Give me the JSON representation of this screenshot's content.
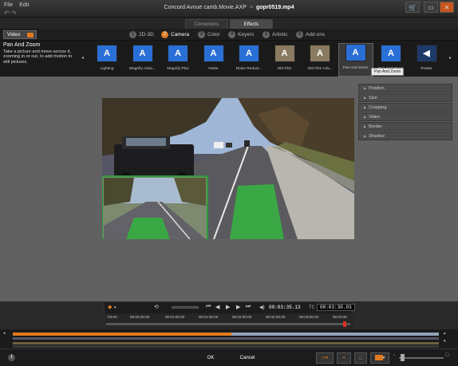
{
  "titlebar": {
    "menu": [
      "File",
      "Edit"
    ],
    "project": "Concord Avnue camb.Movie.AXP",
    "separator": ">",
    "file": "gopr0519.mp4"
  },
  "top_tabs": [
    {
      "label": "Corrections",
      "active": false
    },
    {
      "label": "Effects",
      "active": true
    }
  ],
  "video_tab": "Video",
  "categories": [
    {
      "num": "1",
      "label": "2D-3D",
      "active": false
    },
    {
      "num": "2",
      "label": "Camera",
      "active": true
    },
    {
      "num": "3",
      "label": "Color",
      "active": false
    },
    {
      "num": "4",
      "label": "Keyers",
      "active": false
    },
    {
      "num": "5",
      "label": "Artistic",
      "active": false
    },
    {
      "num": "6",
      "label": "Add-ons",
      "active": false
    }
  ],
  "description": {
    "title": "Pan And Zoom",
    "text": "Take a picture and move across it, zooming in or out, to add motion to still pictures."
  },
  "effects": [
    {
      "label": "Lighting",
      "style": "blue"
    },
    {
      "label": "Magnify Adva...",
      "style": "blue"
    },
    {
      "label": "Magnify Plus",
      "style": "blue"
    },
    {
      "label": "Noise",
      "style": "blue"
    },
    {
      "label": "Noise Reduct...",
      "style": "blue"
    },
    {
      "label": "Old Film",
      "style": "tan"
    },
    {
      "label": "Old Film Adv...",
      "style": "tan"
    },
    {
      "label": "Pan And Zoom",
      "style": "blue",
      "selected": true
    },
    {
      "label": "Pan And Zoom",
      "style": "blue"
    },
    {
      "label": "Rotate",
      "style": "dark"
    }
  ],
  "tooltip": "Pan And Zoom",
  "settings": [
    "Position",
    "Size",
    "Cropping",
    "Video",
    "Border",
    "Shadow"
  ],
  "transport": {
    "duration": "00:03:35.13",
    "tc_label": "TC",
    "timecode": "00:03:30.03",
    "ticks": [
      ":00.00",
      "00:00:30.00",
      "00:01:00.00",
      "00:01:30.00",
      "00:02:00.00",
      "00:02:30.00",
      "00:03:00.00",
      "00:03:30"
    ]
  },
  "bottom": {
    "ok": "OK",
    "cancel": "Cancel",
    "info": "i"
  },
  "colors": {
    "accent": "#e07a1f",
    "effect_blue": "#2a6fd6",
    "effect_tan": "#8a7a60"
  }
}
